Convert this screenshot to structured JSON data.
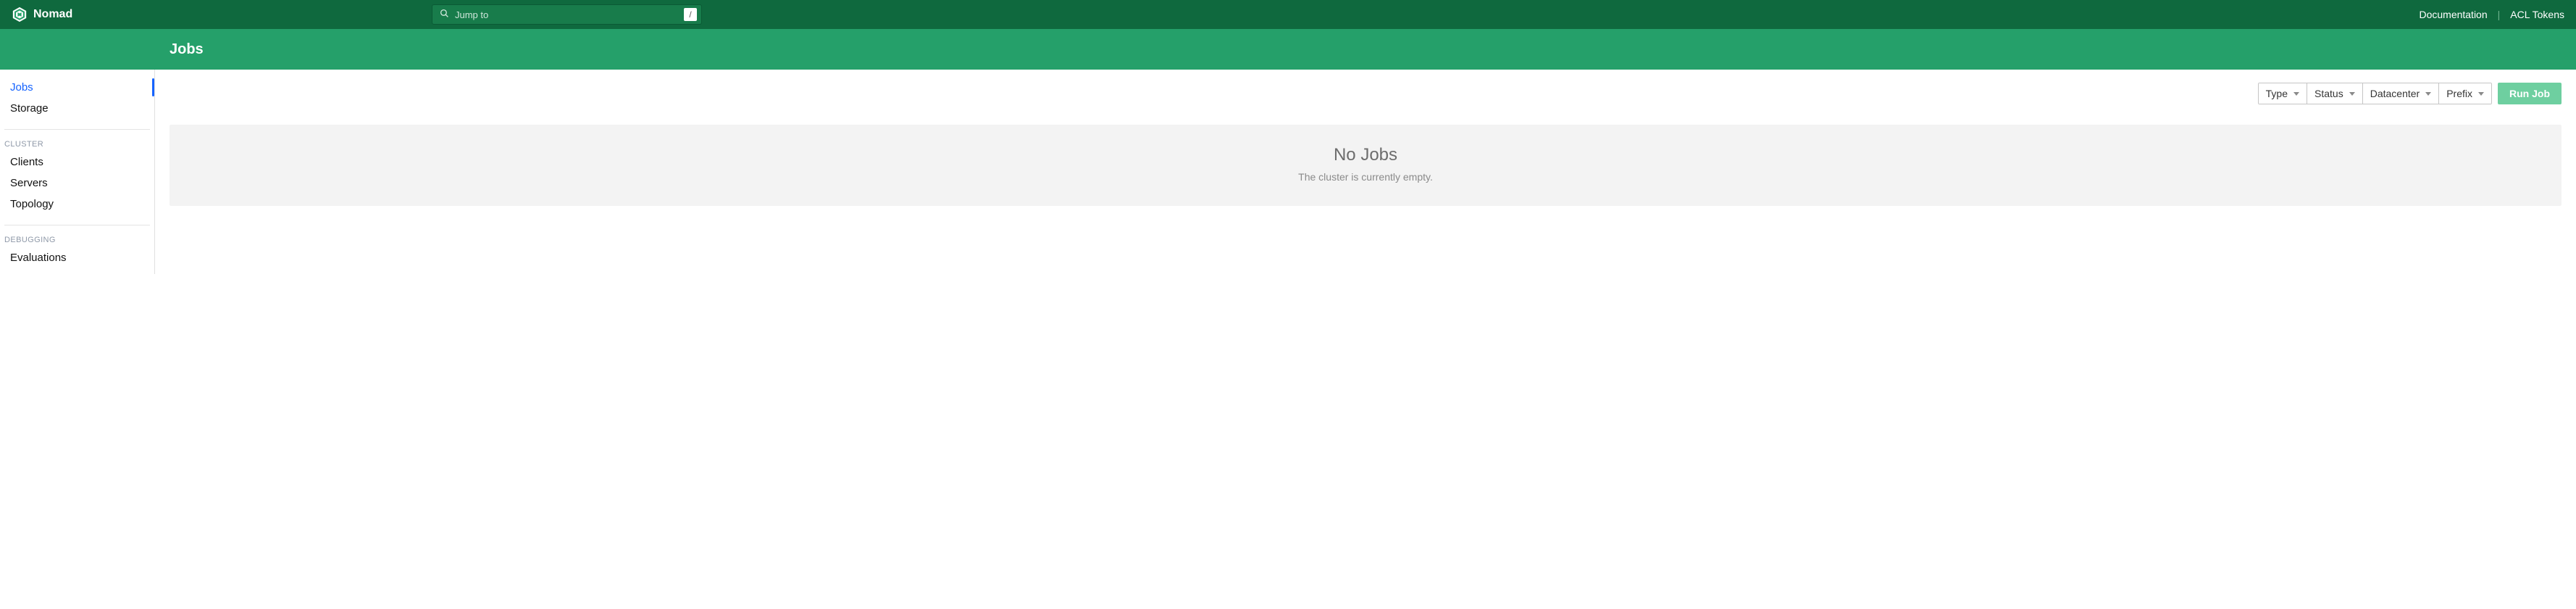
{
  "brand": {
    "name": "Nomad"
  },
  "jumpto": {
    "placeholder": "Jump to",
    "shortcut": "/"
  },
  "topnav_links": {
    "documentation": "Documentation",
    "acl_tokens": "ACL Tokens"
  },
  "subnav": {
    "title": "Jobs"
  },
  "sidebar": {
    "top": [
      {
        "label": "Jobs",
        "active": true
      },
      {
        "label": "Storage",
        "active": false
      }
    ],
    "cluster_heading": "CLUSTER",
    "cluster": [
      {
        "label": "Clients"
      },
      {
        "label": "Servers"
      },
      {
        "label": "Topology"
      }
    ],
    "debugging_heading": "DEBUGGING",
    "debugging": [
      {
        "label": "Evaluations"
      }
    ]
  },
  "toolbar": {
    "facets": [
      {
        "label": "Type"
      },
      {
        "label": "Status"
      },
      {
        "label": "Datacenter"
      },
      {
        "label": "Prefix"
      }
    ],
    "run_label": "Run Job"
  },
  "empty": {
    "title": "No Jobs",
    "subtitle": "The cluster is currently empty."
  }
}
